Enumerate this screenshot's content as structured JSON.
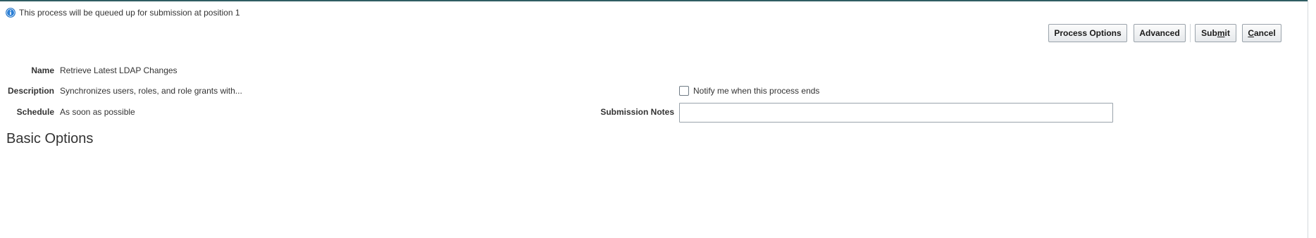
{
  "info": {
    "icon": "info-icon",
    "message": "This process will be queued up for submission at position 1"
  },
  "toolbar": {
    "process_options_label": "Process Options",
    "advanced_label": "Advanced",
    "submit_label_pre": "Sub",
    "submit_label_mnemonic": "m",
    "submit_label_post": "it",
    "cancel_label_mnemonic": "C",
    "cancel_label_post": "ancel"
  },
  "details": {
    "name_label": "Name",
    "name_value": "Retrieve Latest LDAP Changes",
    "description_label": "Description",
    "description_value": "Synchronizes users, roles, and role grants with...",
    "schedule_label": "Schedule",
    "schedule_value": "As soon as possible"
  },
  "notify": {
    "checked": false,
    "label": "Notify me when this process ends"
  },
  "submission_notes": {
    "label": "Submission Notes",
    "value": ""
  },
  "section": {
    "title": "Basic Options"
  },
  "colors": {
    "top_rule": "#2f5d62",
    "info_icon": "#1f73c8"
  }
}
